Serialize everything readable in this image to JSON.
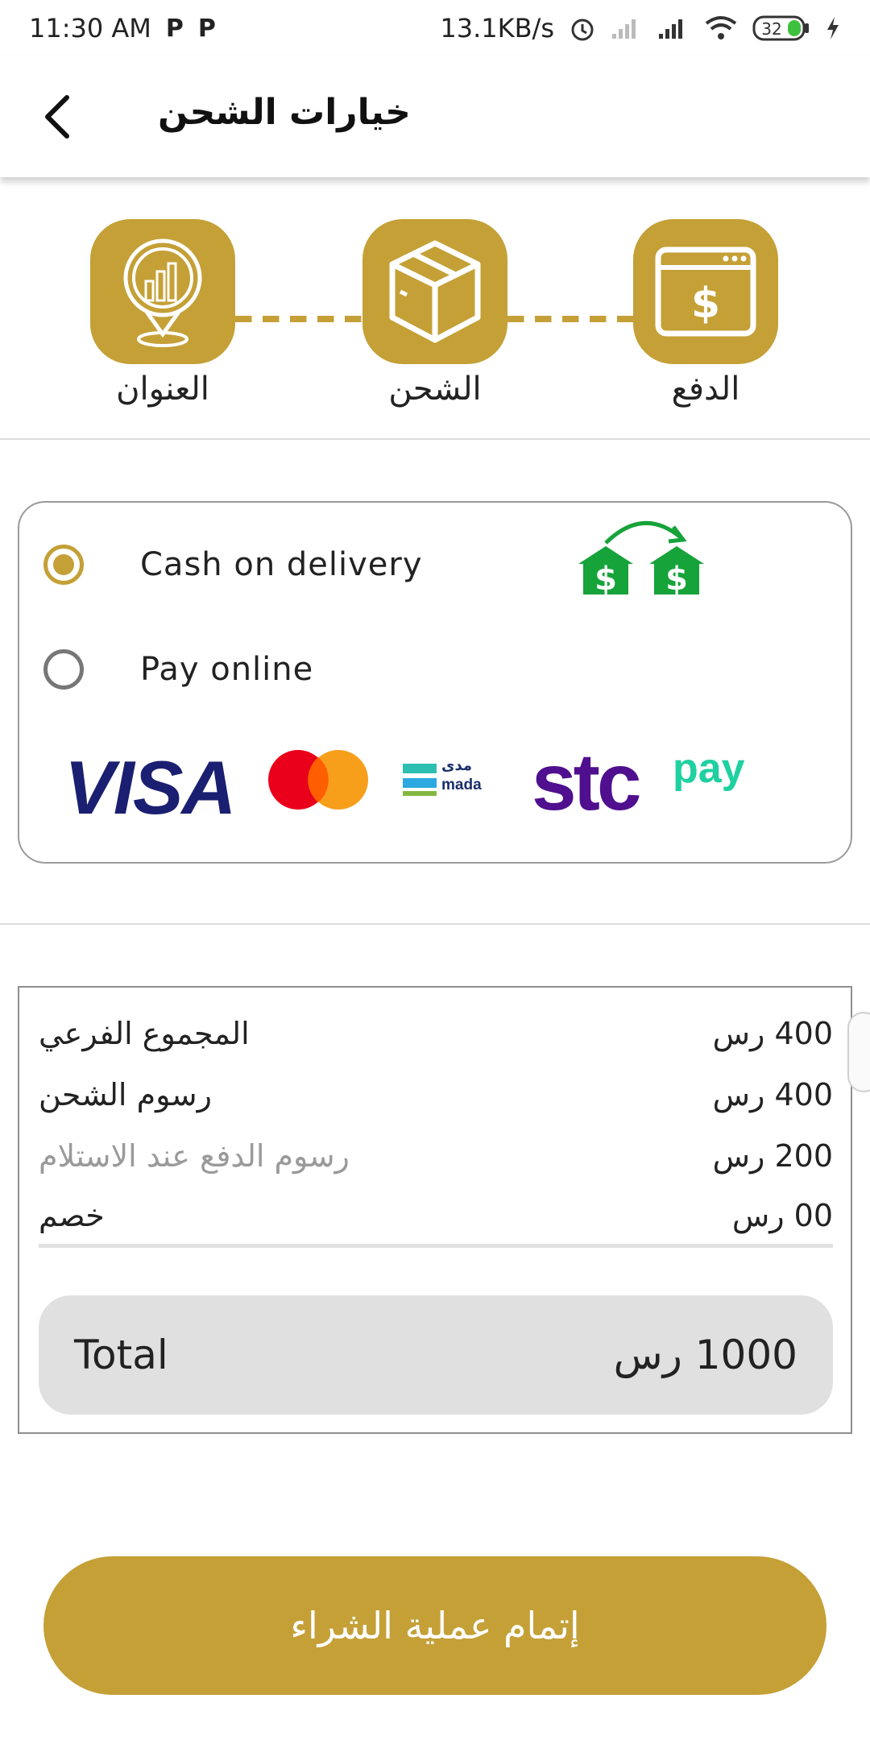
{
  "status_bar": {
    "time": "11:30 AM",
    "p1": "P",
    "p2": "P",
    "network_speed": "13.1KB/s",
    "battery": "32"
  },
  "header": {
    "title": "خيارات الشحن"
  },
  "steps": [
    {
      "label": "العنوان",
      "icon": "location-chart-icon"
    },
    {
      "label": "الشحن",
      "icon": "box-icon"
    },
    {
      "label": "الدفع",
      "icon": "payment-window-icon"
    }
  ],
  "payment": {
    "options": [
      {
        "label": "Cash on delivery",
        "selected": true
      },
      {
        "label": "Pay online",
        "selected": false
      }
    ],
    "brands": {
      "visa": "VISA",
      "mada_ar": "مدى",
      "mada_en": "mada",
      "stc": "stc",
      "stc_pay": "pay"
    }
  },
  "summary": {
    "rows": [
      {
        "label": "المجموع الفرعي",
        "value": "400 رس"
      },
      {
        "label": "رسوم الشحن",
        "value": "400 رس"
      },
      {
        "label": "رسوم الدفع عند الاستلام",
        "value": "200 رس"
      },
      {
        "label": "خصم",
        "value": "00 رس"
      }
    ],
    "total_label": "Total",
    "total_value": "1000 رس"
  },
  "checkout_label": "إتمام عملية الشراء",
  "colors": {
    "accent": "#c4a037",
    "green_icon": "#16a33a",
    "visa_blue": "#1a1f71",
    "stc_purple": "#4f0f8f",
    "stc_pay_green": "#1fd0a0"
  }
}
